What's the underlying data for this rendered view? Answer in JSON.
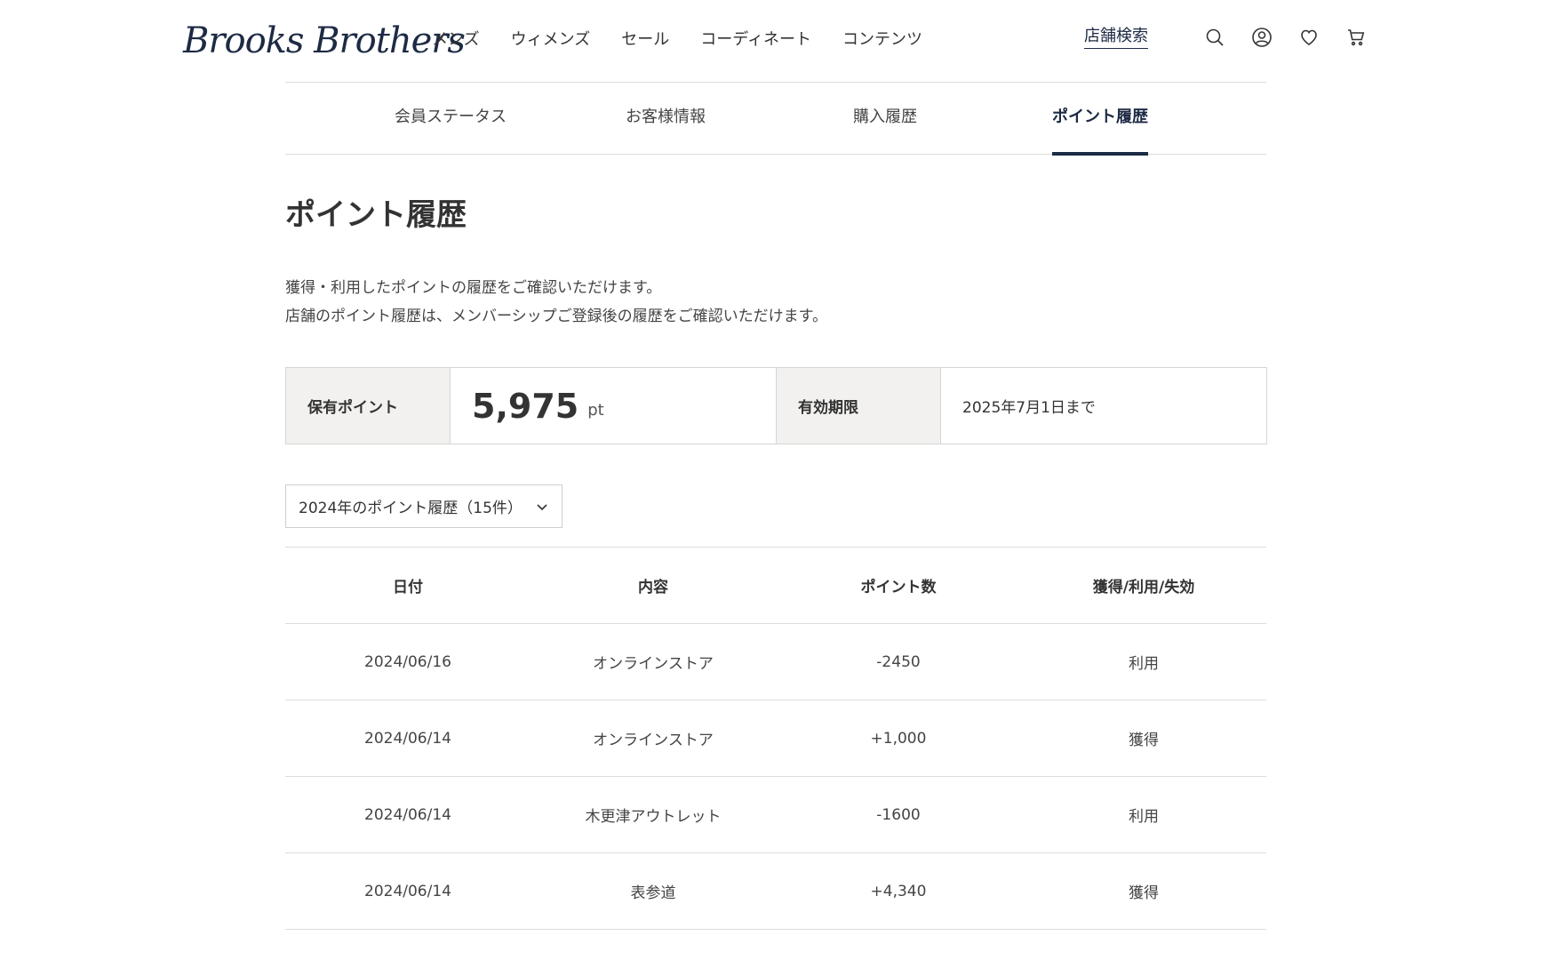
{
  "header": {
    "logo_text": "Brooks Brothers",
    "nav": [
      "メンズ",
      "ウィメンズ",
      "セール",
      "コーディネート",
      "コンテンツ"
    ],
    "store_search": "店舗検索",
    "icons": [
      "search-icon",
      "account-icon",
      "heart-icon",
      "cart-icon"
    ]
  },
  "tabs": [
    {
      "label": "会員ステータス",
      "active": false
    },
    {
      "label": "お客様情報",
      "active": false
    },
    {
      "label": "購入履歴",
      "active": false
    },
    {
      "label": "ポイント履歴",
      "active": true
    }
  ],
  "page": {
    "title": "ポイント履歴",
    "desc_line1": "獲得・利用したポイントの履歴をご確認いただけます。",
    "desc_line2": "店舗のポイント履歴は、メンバーシップご登録後の履歴をご確認いただけます。"
  },
  "summary": {
    "points_label": "保有ポイント",
    "points_value": "5,975",
    "points_unit": "pt",
    "expiry_label": "有効期限",
    "expiry_value": "2025年7月1日まで"
  },
  "year_select": {
    "selected": "2024年のポイント履歴（15件）"
  },
  "table": {
    "headers": [
      "日付",
      "内容",
      "ポイント数",
      "獲得/利用/失効"
    ],
    "rows": [
      [
        "2024/06/16",
        "オンラインストア",
        "-2450",
        "利用"
      ],
      [
        "2024/06/14",
        "オンラインストア",
        "+1,000",
        "獲得"
      ],
      [
        "2024/06/14",
        "木更津アウトレット",
        "-1600",
        "利用"
      ],
      [
        "2024/06/14",
        "表参道",
        "+4,340",
        "獲得"
      ]
    ]
  },
  "colors": {
    "brand": "#1d2a44",
    "label_bg": "#f2f1ef",
    "border": "#dcdcdc"
  }
}
